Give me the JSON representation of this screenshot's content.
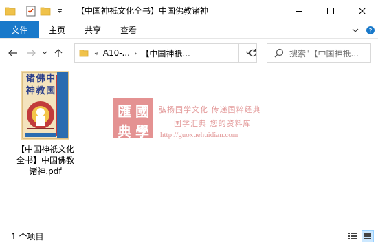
{
  "window": {
    "title": "【中国神祇文化全书】中国佛教诸神"
  },
  "ribbon": {
    "file_tab": "文件",
    "tabs": [
      "主页",
      "共享",
      "查看"
    ]
  },
  "address": {
    "overflow": "«",
    "segments": [
      "A10-...",
      "【中国神祇..."
    ]
  },
  "search": {
    "placeholder": "搜索\"【中国神祇..."
  },
  "file": {
    "name": "【中国神祇文化全书】中国佛教诸神.pdf",
    "cover_title": "中国佛教诸神"
  },
  "watermark": {
    "seal_chars": [
      "匯",
      "國",
      "典",
      "學"
    ],
    "line1": "弘扬国学文化 传递国粹经典",
    "line2": "国学汇典 您的资料库",
    "url": "http://guoxuehuidian.com"
  },
  "status": {
    "item_count": "1 个项目"
  },
  "colors": {
    "accent": "#1979ca",
    "folder": "#f0c24a",
    "watermark": "#e07f7f"
  }
}
